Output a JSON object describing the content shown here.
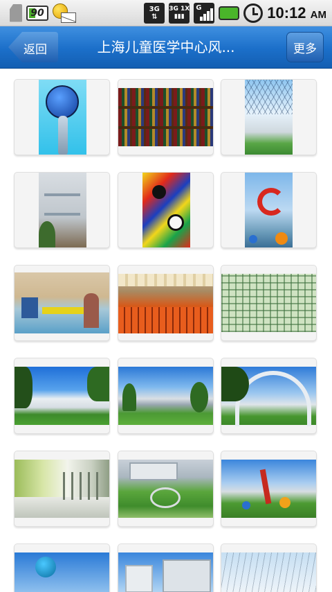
{
  "statusbar": {
    "battery_small_label": "90",
    "network_3g_top": "3G",
    "network_1x_top": "3G 1X",
    "signal_label": "G",
    "time": "10:12",
    "ampm": "AM"
  },
  "titlebar": {
    "back_label": "返回",
    "title": "上海儿童医学中心风...",
    "more_label": "更多"
  },
  "gallery": {
    "items": [
      {
        "name": "sculpture-globe-photo"
      },
      {
        "name": "bookshelf-photo"
      },
      {
        "name": "glass-atrium-photo"
      },
      {
        "name": "interior-stairwell-photo"
      },
      {
        "name": "abstract-painting-photo"
      },
      {
        "name": "fountain-sculpture-photo"
      },
      {
        "name": "playroom-photo"
      },
      {
        "name": "auditorium-photo"
      },
      {
        "name": "tiled-wall-photo"
      },
      {
        "name": "campus-building-photo"
      },
      {
        "name": "campus-lawn-photo"
      },
      {
        "name": "arch-gate-photo"
      },
      {
        "name": "corridor-photo"
      },
      {
        "name": "aerial-garden-photo"
      },
      {
        "name": "plaza-sculpture-photo"
      },
      {
        "name": "globe-sculpture-photo"
      },
      {
        "name": "hospital-exterior-photo"
      },
      {
        "name": "atrium-interior-photo"
      }
    ]
  },
  "colors": {
    "titlebar": "#1b6fc9",
    "statusbar": "#e6e6e6"
  }
}
